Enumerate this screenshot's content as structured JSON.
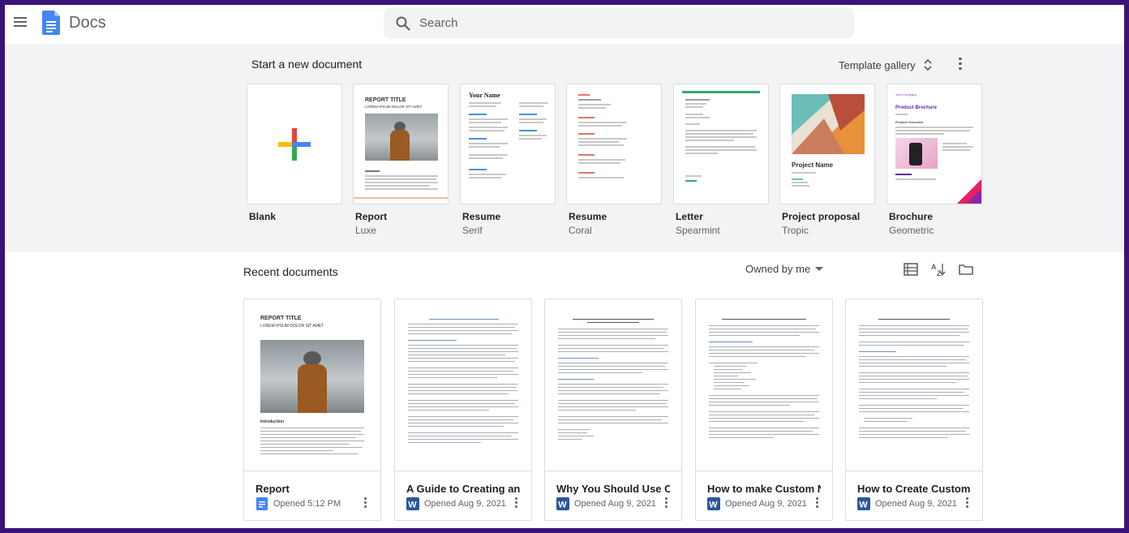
{
  "header": {
    "app_title": "Docs",
    "search_placeholder": "Search"
  },
  "templates": {
    "section_title": "Start a new document",
    "gallery_label": "Template gallery",
    "items": [
      {
        "name": "Blank",
        "sub": ""
      },
      {
        "name": "Report",
        "sub": "Luxe"
      },
      {
        "name": "Resume",
        "sub": "Serif"
      },
      {
        "name": "Resume",
        "sub": "Coral"
      },
      {
        "name": "Letter",
        "sub": "Spearmint"
      },
      {
        "name": "Project proposal",
        "sub": "Tropic"
      },
      {
        "name": "Brochure",
        "sub": "Geometric"
      }
    ],
    "thumb_text": {
      "report_title": "REPORT TITLE",
      "report_subtitle": "LOREM IPSUM DOLOR SIT AMET",
      "resume_name": "Your Name",
      "proposal_name": "Project Name",
      "brochure_company": "Your Company",
      "brochure_title": "Product Brochure",
      "brochure_overview": "Product Overview"
    }
  },
  "recent": {
    "section_title": "Recent documents",
    "owner_filter": "Owned by me",
    "documents": [
      {
        "title": "Report",
        "opened": "Opened 5:12 PM",
        "type": "docs"
      },
      {
        "title": "A Guide to Creating and Using Custom Nail Stickers",
        "opened": "Opened Aug 9, 2021",
        "type": "word"
      },
      {
        "title": "Why You Should Use Custom Nail Stickers",
        "opened": "Opened Aug 9, 2021",
        "type": "word"
      },
      {
        "title": "How to make Custom Nail Stickers",
        "opened": "Opened Aug 9, 2021",
        "type": "word"
      },
      {
        "title": "How to Create Custom Vinyl Stickers",
        "opened": "Opened Aug 9, 2021",
        "type": "word"
      }
    ],
    "doc_thumb_text": {
      "report_title": "REPORT TITLE",
      "report_subtitle": "LOREM IPSUM DOLOR SIT AMET",
      "report_intro": "Introduction"
    }
  },
  "colors": {
    "frame_border": "#3a1378",
    "docs_blue": "#4285f4",
    "word_blue": "#2b579a"
  }
}
